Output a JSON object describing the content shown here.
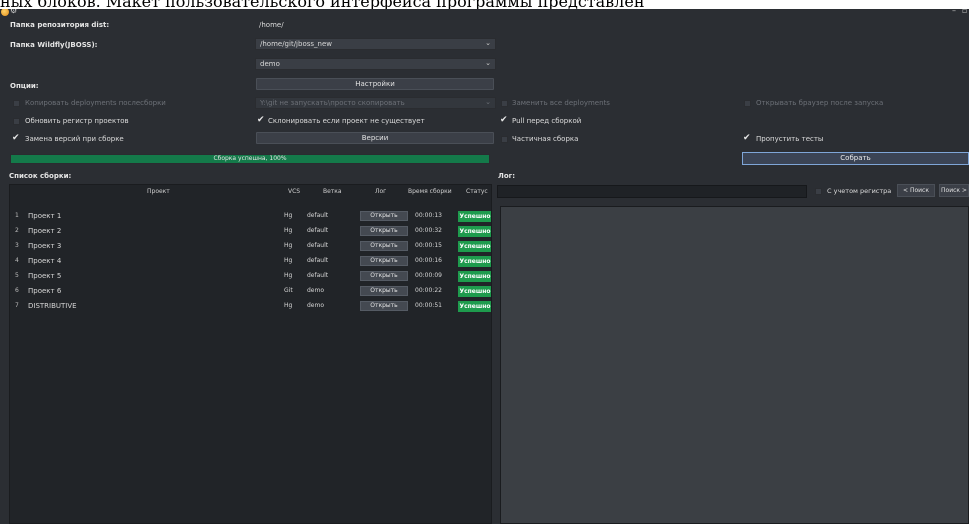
{
  "doc_text": "ных блоков. Макет пользовательского интерфейса программы представлен",
  "labels": {
    "repo_dir": "Папка репозитория dist:",
    "wildfly_dir": "Папка Wildfly(JBOSS):",
    "options": "Опции:",
    "build_list": "Список сборки:",
    "log": "Лог:"
  },
  "fields": {
    "repo_dir_value": "/home/",
    "wildfly_dir_value": "/home/git/jboss_new",
    "profile_value": "demo",
    "deploy_placeholder": "Y:\\git не запускать\\просто скопировать"
  },
  "buttons": {
    "settings": "Настройки",
    "versions": "Версии",
    "build": "Собрать",
    "prev_search": "< Поиск",
    "next_search": "Поиск >"
  },
  "options": {
    "copy_deployments": {
      "label": "Копировать deployments послесборки",
      "checked": false,
      "enabled": false
    },
    "replace_all_deployments": {
      "label": "Заменить все deployments",
      "checked": false,
      "enabled": false
    },
    "open_browser": {
      "label": "Открывать браузер после запуска",
      "checked": false,
      "enabled": false
    },
    "update_registry": {
      "label": "Обновить регистр проектов",
      "checked": false,
      "enabled": true
    },
    "clone_if_missing": {
      "label": "Склонировать если проект не существует",
      "checked": true,
      "enabled": true
    },
    "pull_before_build": {
      "label": "Pull перед сборкой",
      "checked": true,
      "enabled": true
    },
    "replace_versions": {
      "label": "Замена версий при сборке",
      "checked": true,
      "enabled": true
    },
    "partial_build": {
      "label": "Частичная сборка",
      "checked": false,
      "enabled": true
    },
    "skip_tests": {
      "label": "Пропустить тесты",
      "checked": true,
      "enabled": true
    }
  },
  "progress": {
    "text": "Сборка успешна, 100%",
    "value": 1.0
  },
  "search": {
    "case_sensitive_label": "С учетом регистра"
  },
  "table": {
    "columns": [
      "Проект",
      "VCS",
      "Ветка",
      "Лог",
      "Время сборки",
      "Статус"
    ],
    "open_label": "Открыть",
    "rows": [
      {
        "num": "1",
        "project": "Проект 1",
        "vcs": "Hg",
        "branch": "default",
        "time": "00:00:13",
        "status": "Успешно"
      },
      {
        "num": "2",
        "project": "Проект 2",
        "vcs": "Hg",
        "branch": "default",
        "time": "00:00:32",
        "status": "Успешно"
      },
      {
        "num": "3",
        "project": "Проект 3",
        "vcs": "Hg",
        "branch": "default",
        "time": "00:00:15",
        "status": "Успешно"
      },
      {
        "num": "4",
        "project": "Проект 4",
        "vcs": "Hg",
        "branch": "default",
        "time": "00:00:16",
        "status": "Успешно"
      },
      {
        "num": "5",
        "project": "Проект 5",
        "vcs": "Hg",
        "branch": "default",
        "time": "00:00:09",
        "status": "Успешно"
      },
      {
        "num": "6",
        "project": "Проект 6",
        "vcs": "Git",
        "branch": "demo",
        "time": "00:00:22",
        "status": "Успешно"
      },
      {
        "num": "7",
        "project": "DISTRIBUTIVE",
        "vcs": "Hg",
        "branch": "demo",
        "time": "00:00:51",
        "status": "Успешно"
      }
    ]
  },
  "colors": {
    "background": "#2b2e33",
    "success": "#1e9b4d",
    "progress": "#147a4a",
    "accent": "#7fa6d8"
  }
}
